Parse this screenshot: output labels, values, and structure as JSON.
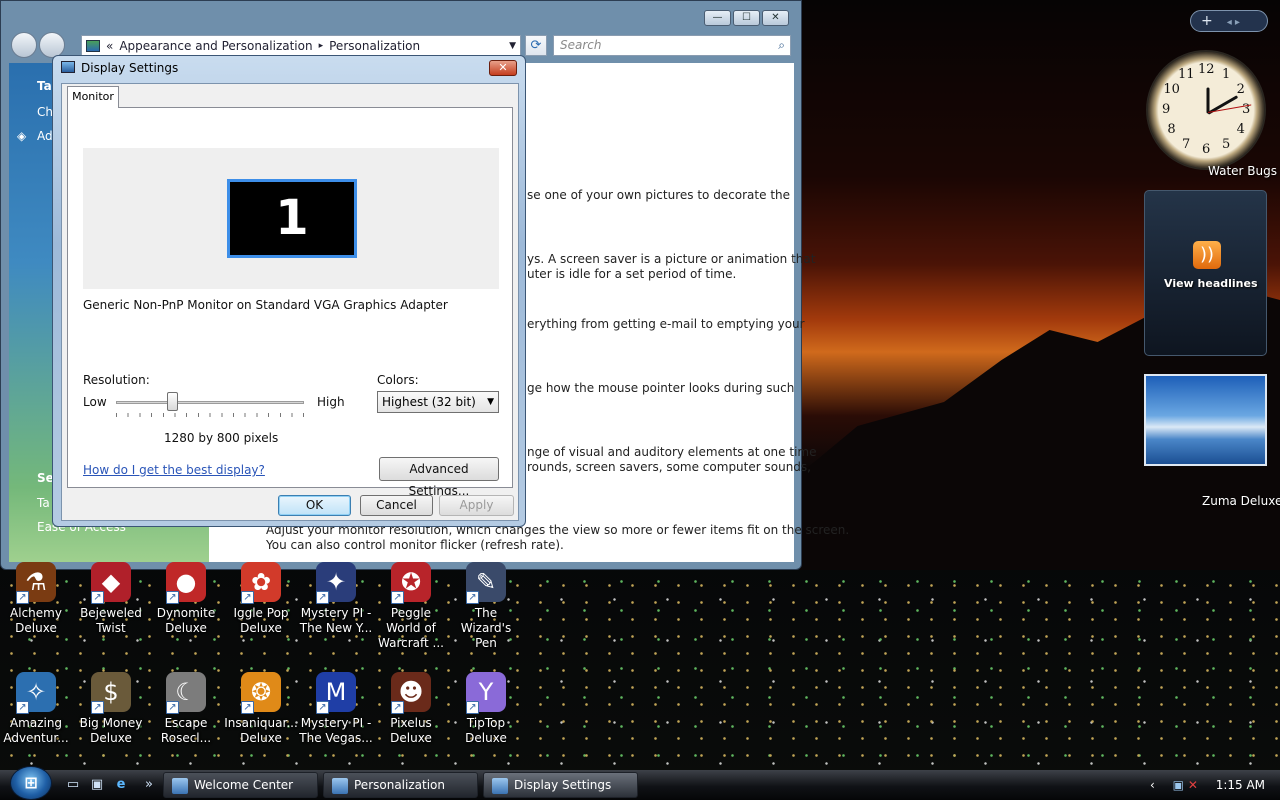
{
  "main_window": {
    "breadcrumb": [
      "Appearance and Personalization",
      "Personalization"
    ],
    "breadcrumb_sep": "▸",
    "breadcrumb_prefix": "«",
    "search_placeholder": "Search",
    "controls": {
      "minimize": "—",
      "maximize": "☐",
      "close": "✕"
    },
    "left_pane": {
      "line1": "Ta",
      "line2": "Ch",
      "line3": "Ad",
      "line4": "Se",
      "line5": "Ta",
      "line6": "Ease of Access"
    },
    "content_lines": [
      "se one of your own pictures to decorate the",
      "ys. A screen saver is a picture or animation that",
      "uter is idle for a set period of time.",
      "erything from getting e-mail to emptying your",
      "ge how the mouse pointer looks during such",
      "nge of visual and auditory elements at one time",
      "rounds, screen savers, some computer sounds,",
      "Adjust your monitor resolution, which changes the view so more or fewer items fit on the screen.",
      "You can also control monitor flicker (refresh rate)."
    ]
  },
  "dialog": {
    "title": "Display Settings",
    "close": "✕",
    "tab": "Monitor",
    "monitor_number": "1",
    "monitor_name": "Generic Non-PnP Monitor on Standard VGA Graphics Adapter",
    "resolution_label": "Resolution:",
    "low": "Low",
    "high": "High",
    "resolution_value": "1280 by 800 pixels",
    "resolution_slider_fraction": 0.3,
    "colors_label": "Colors:",
    "colors_value": "Highest (32 bit)",
    "help_link": "How do I get the best display?",
    "advanced_button": "Advanced Settings...",
    "ok": "OK",
    "cancel": "Cancel",
    "apply": "Apply"
  },
  "gadgets": {
    "top_bar": "+",
    "clock_label": "Water Bugs",
    "feed_text": "View headlines",
    "photo_label": "Zuma Deluxe",
    "clock_numbers": [
      "12",
      "1",
      "2",
      "3",
      "4",
      "5",
      "6",
      "7",
      "8",
      "9",
      "10",
      "11"
    ]
  },
  "desktop_icons": [
    {
      "label": "Alchemy Deluxe",
      "glyph": "⚗",
      "color": "#7a3b12"
    },
    {
      "label": "Bejeweled Twist",
      "glyph": "◆",
      "color": "#b0202a"
    },
    {
      "label": "Dynomite Deluxe",
      "glyph": "●",
      "color": "#c02828"
    },
    {
      "label": "Iggle Pop Deluxe",
      "glyph": "✿",
      "color": "#d23a2a"
    },
    {
      "label": "Mystery PI - The New Y...",
      "glyph": "✦",
      "color": "#2a3d7a"
    },
    {
      "label": "Peggle World of Warcraft ...",
      "glyph": "✪",
      "color": "#b8242a"
    },
    {
      "label": "The Wizard's Pen",
      "glyph": "✎",
      "color": "#3a4a6a"
    },
    {
      "label": "Amazing Adventur...",
      "glyph": "✧",
      "color": "#2c6fb0"
    },
    {
      "label": "Big Money Deluxe",
      "glyph": "$",
      "color": "#6a5a3a"
    },
    {
      "label": "Escape Rosecl...",
      "glyph": "☾",
      "color": "#7c7c7c"
    },
    {
      "label": "Insaniquar... Deluxe",
      "glyph": "❂",
      "color": "#e08a18"
    },
    {
      "label": "Mystery PI - The Vegas...",
      "glyph": "M",
      "color": "#1f3ea6"
    },
    {
      "label": "Pixelus Deluxe",
      "glyph": "☻",
      "color": "#6a2a1a"
    },
    {
      "label": "TipTop Deluxe",
      "glyph": "Y",
      "color": "#8a6ad8"
    }
  ],
  "taskbar": {
    "start": "⊞",
    "quick_launch": [
      "▭",
      "▣",
      "e",
      "»"
    ],
    "tasks": [
      "Welcome Center",
      "Personalization",
      "Display Settings"
    ],
    "tray_arrow": "‹",
    "time": "1:15 AM"
  },
  "colors": {
    "accent": "#3d8ee8",
    "link": "#2a55b8"
  }
}
